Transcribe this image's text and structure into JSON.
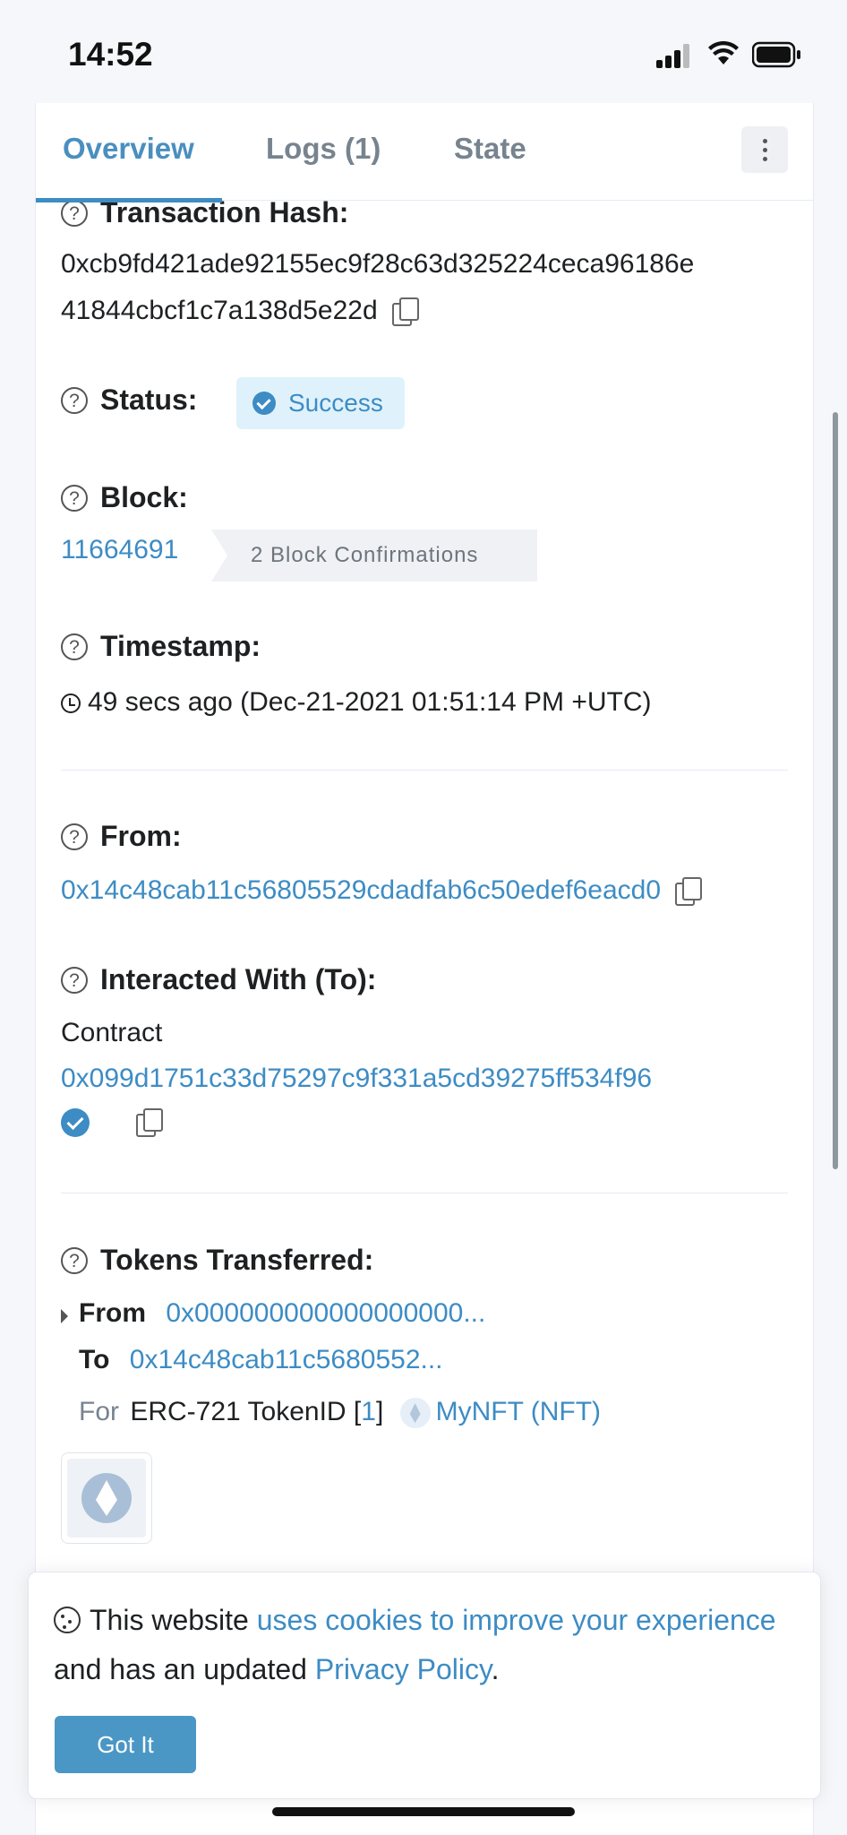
{
  "status_bar": {
    "time": "14:52"
  },
  "tabs": [
    {
      "label": "Overview",
      "active": true
    },
    {
      "label": "Logs (1)",
      "active": false
    },
    {
      "label": "State",
      "active": false
    }
  ],
  "fields": {
    "tx_hash_label": "Transaction Hash:",
    "tx_hash_line1": "0xcb9fd421ade92155ec9f28c63d325224ceca96186e",
    "tx_hash_line2": "41844cbcf1c7a138d5e22d",
    "status_label": "Status:",
    "status_value": "Success",
    "block_label": "Block:",
    "block_number": "11664691",
    "block_confirmations": "2 Block Confirmations",
    "timestamp_label": "Timestamp:",
    "timestamp_value": "49 secs ago (Dec-21-2021 01:51:14 PM +UTC)",
    "from_label": "From:",
    "from_address": "0x14c48cab11c56805529cdadfab6c50edef6eacd0",
    "to_label": "Interacted With (To):",
    "to_contract_prefix": "Contract",
    "to_address": "0x099d1751c33d75297c9f331a5cd39275ff534f96",
    "tokens_label": "Tokens Transferred:"
  },
  "token_transfer": {
    "from_label": "From",
    "from_address": "0x000000000000000000...",
    "to_label": "To",
    "to_address": "0x14c48cab11c5680552...",
    "for_label": "For",
    "token_standard": "ERC-721 TokenID [",
    "token_id": "1",
    "token_close": "]",
    "token_name": "MyNFT (NFT)"
  },
  "cookie_banner": {
    "text_1": "This website ",
    "link_1": "uses cookies to improve your experience",
    "text_2": " and has an updated ",
    "link_2": "Privacy Policy",
    "text_3": ".",
    "button": "Got It"
  },
  "colors": {
    "accent": "#3d8cc4",
    "success_bg": "#dff2fb"
  }
}
